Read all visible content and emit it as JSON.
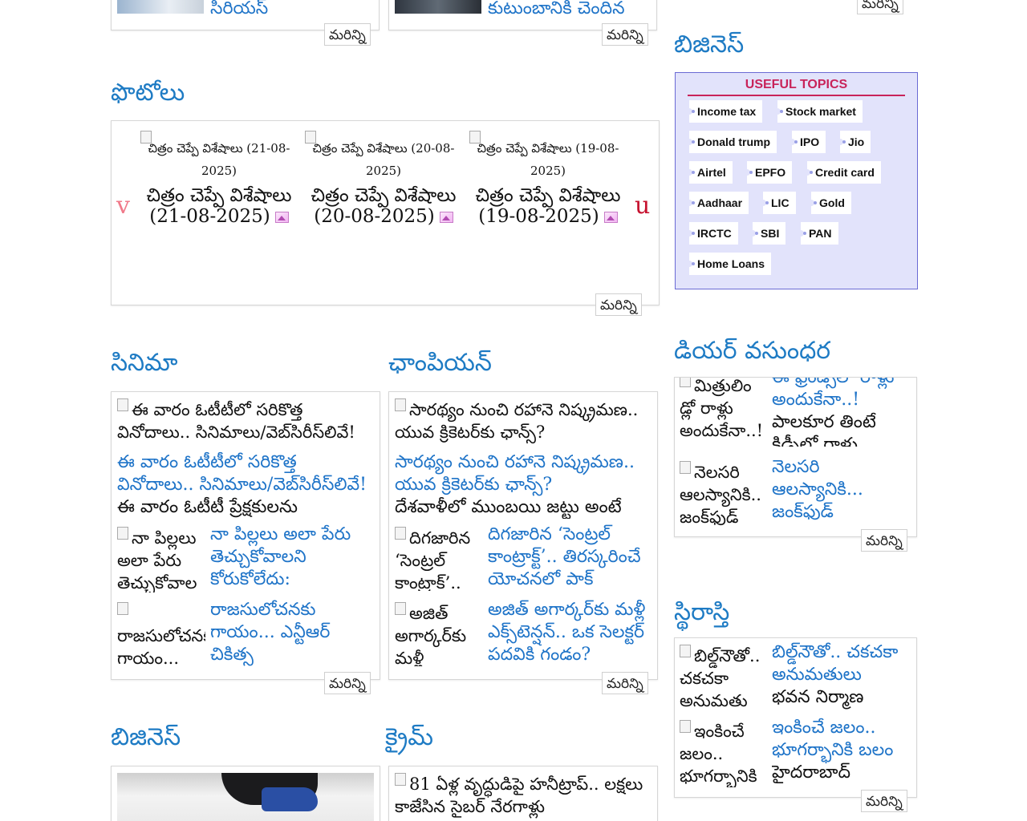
{
  "more_label": "మరిన్ని",
  "top_left_cards": {
    "card1_text": "సిరియస్",
    "card2_text": "కుటుంబానికి చెందిన"
  },
  "photos": {
    "heading": "ఫొటోలు",
    "prev_arrow": "v",
    "next_arrow": "u",
    "items": [
      {
        "caption": "చిత్రం చెప్పే విశేషాలు (21-08-2025)",
        "title": "చిత్రం చెప్పే విశేషాలు (21-08-2025)"
      },
      {
        "caption": "చిత్రం చెప్పే విశేషాలు (20-08-2025)",
        "title": "చిత్రం చెప్పే విశేషాలు (20-08-2025)"
      },
      {
        "caption": "చిత్రం చెప్పే విశేషాలు (19-08-2025)",
        "title": "చిత్రం చెప్పే విశేషాలు (19-08-2025)"
      }
    ]
  },
  "cinema": {
    "heading": "సినిమా",
    "lead": {
      "img_alt": "ఈ వారం ఓటీటీలో సరికొత్త వినోదాలు.. సినిమాలు/వెబ్‌సిరీస్‌లివే!",
      "title": "ఈ వారం ఓటీటీలో సరికొత్త వినోదాలు.. సినిమాలు/వెబ్‌సిరీస్‌లివే!",
      "desc": "ఈ వారం ఓటీటీ ప్రేక్షకులను"
    },
    "items": [
      {
        "img_alt": "నా పిల్లలు అలా పేరు తెచ్చుకోవాల",
        "title": "నా పిల్లలు అలా పేరు తెచ్చుకోవాలని కోరుకోలేదు:"
      },
      {
        "img_alt": "రాజసులోచనకు గాయం...",
        "title": "రాజసులోచనకు గాయం... ఎన్టీఆర్ చికిత్స"
      }
    ]
  },
  "champion": {
    "heading": "ఛాంపియన్",
    "lead": {
      "img_alt": "సారథ్యం నుంచి రహానె నిష్క్రమణ.. యువ క్రికెటర్‌కు ఛాన్స్?",
      "title": "సారథ్యం నుంచి రహానె నిష్క్రమణ.. యువ క్రికెటర్‌కు ఛాన్స్?",
      "desc": "దేశవాళీలో ముంబయి జట్టు అంటే"
    },
    "items": [
      {
        "img_alt": "దిగజారిన ‘సెంట్రల్ కాంట్రాక్’..",
        "title": "దిగజారిన ‘సెంట్రల్ కాంట్రాక్ట్’.. తిరస్కరించే యోచనలో పాక్"
      },
      {
        "img_alt": "అజిత్ అగార్కర్‌కు మళ్లీ",
        "title": "అజిత్ అగార్కర్‌కు మళ్లీ ఎక్స్‌టెన్షన్.. ఒక సెలక్టర్ పదవికి గండం?"
      }
    ]
  },
  "business_left": {
    "heading": "బిజినెస్"
  },
  "crime": {
    "heading": "క్రైమ్",
    "lead_img_alt": "81 ఏళ్ల వృద్ధుడిపై హనీట్రాప్.. లక్షలు కాజేసిన సైబర్ నేరగాళ్లు"
  },
  "sidebar": {
    "business_heading": "బిజినెస్",
    "useful_topics": {
      "heading": "USEFUL TOPICS",
      "topics": [
        "Income tax",
        "Stock market",
        "Donald trump",
        "IPO",
        "Jio",
        "Airtel",
        "EPFO",
        "Credit card",
        "Aadhaar",
        "LIC",
        "Gold",
        "IRCTC",
        "SBI",
        "PAN",
        "Home Loans"
      ]
    },
    "dear_vasundhara": {
      "heading": "డియర్ వసుంధర",
      "items": [
        {
          "img_alt": "మిత్రులిం డ్లో రాళ్లు అందుకేనా..!",
          "title": "ఈ ఫ్రెండ్స్‌లో రాళ్లు అందుకేనా..!",
          "desc": "పాలకూర తింటే కిడ్నీలో రాళ్లు"
        },
        {
          "img_alt": "నెలసరి ఆలస్యానికి.. జంక్‌ఫుడ్",
          "title": "నెలసరి ఆలస్యానికి... జంక్‌ఫుడ్",
          "desc": ""
        }
      ]
    },
    "sthirasthi": {
      "heading": "స్థిరాస్తి",
      "items": [
        {
          "img_alt": "బిల్డ్‌నౌతో.. చకచకా అనుమతు",
          "title": "బిల్డ్‌నౌతో.. చకచకా అనుమతులు",
          "desc": "భవన నిర్మాణ"
        },
        {
          "img_alt": "ఇంకించే జలం.. భూగర్భానికి",
          "title": "ఇంకించే జలం.. భూగర్భానికి బలం",
          "desc": "హైదరాబాద్"
        }
      ]
    }
  }
}
